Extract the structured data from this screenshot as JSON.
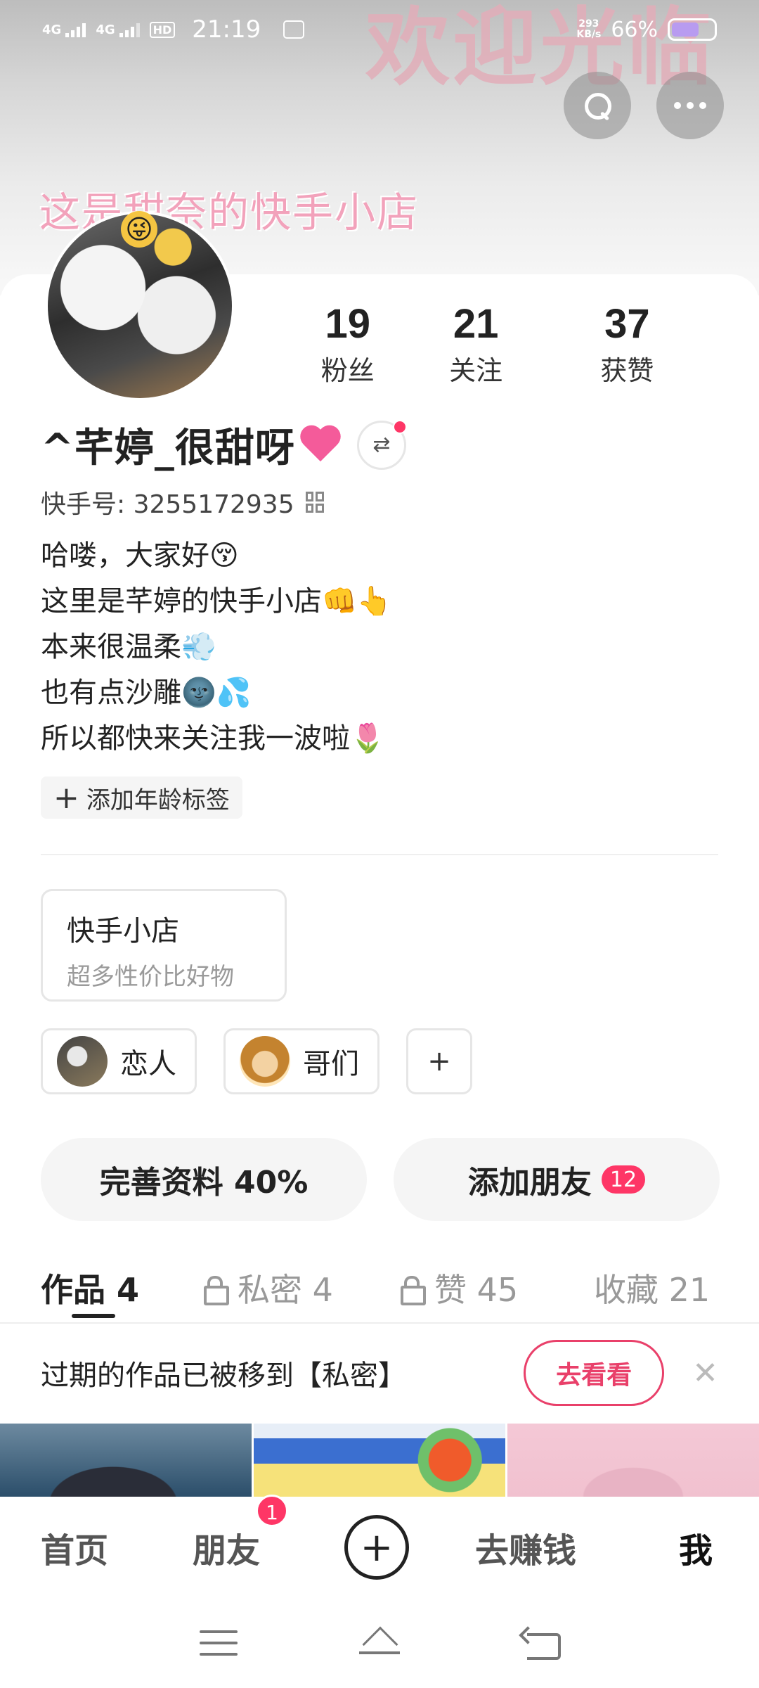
{
  "status_bar": {
    "signal_1": "4G",
    "signal_2": "4G",
    "hd": "HD",
    "time": "21:19",
    "net_speed_value": "293",
    "net_speed_unit": "KB/s",
    "battery_pct": "66%",
    "battery_level": 0.66,
    "battery_color": "#b89bf0"
  },
  "header": {
    "banner_text": "欢迎光临",
    "shop_banner_text": "这是甜奈的快手小店",
    "search_icon": "search-icon",
    "more_icon": "more-dots-icon"
  },
  "profile": {
    "stats": [
      {
        "value": "19",
        "label": "粉丝"
      },
      {
        "value": "21",
        "label": "关注"
      },
      {
        "value": "37",
        "label": "获赞"
      }
    ],
    "nickname": "^芊婷_很甜呀",
    "nickname_icon": "pink-heart-icon",
    "switch_icon": "switch-account-icon",
    "account_id": "快手号: 3255172935",
    "bio": [
      "哈喽，大家好😚",
      "这里是芊婷的快手小店👊👆",
      "本来很温柔💨",
      "也有点沙雕🌚💦",
      "所以都快来关注我一波啦🌷"
    ],
    "age_tag": "添加年龄标签",
    "age_tag_plus": "+"
  },
  "shop": {
    "title": "快手小店",
    "subtitle": "超多性价比好物"
  },
  "relations": {
    "chips": [
      {
        "label": "恋人"
      },
      {
        "label": "哥们"
      }
    ],
    "add_label": "+"
  },
  "actions": {
    "complete_profile": "完善资料 40%",
    "add_friends": "添加朋友",
    "add_friends_badge": "12"
  },
  "tabs": [
    {
      "label": "作品 4",
      "active": true
    },
    {
      "label": "私密 4",
      "locked": true
    },
    {
      "label": "赞 45",
      "locked": true
    },
    {
      "label": "收藏 21"
    }
  ],
  "notice": {
    "text": "过期的作品已被移到【私密】",
    "button": "去看看",
    "close": "✕"
  },
  "bottom_nav": {
    "home": "首页",
    "friends": "朋友",
    "friends_badge": "1",
    "plus": "+",
    "earn": "去赚钱",
    "me": "我"
  },
  "accent_colors": {
    "brand_red": "#fe3666",
    "notice_button": "#e9406a"
  }
}
